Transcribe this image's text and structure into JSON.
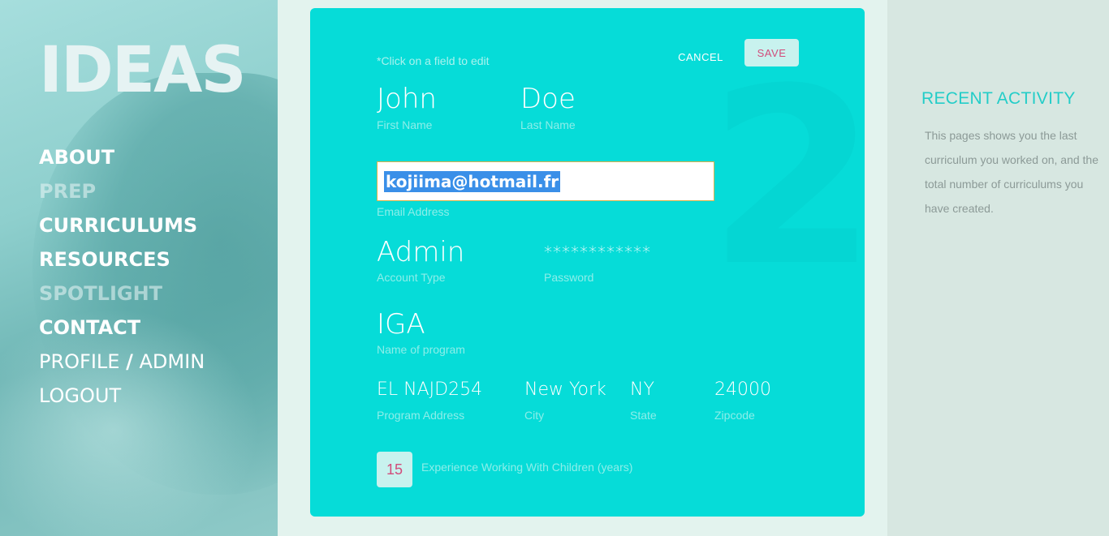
{
  "brand": {
    "logo": "IDEAS"
  },
  "nav": {
    "items": [
      {
        "label": "ABOUT"
      },
      {
        "label": "PREP"
      },
      {
        "label": "CURRICULUMS"
      },
      {
        "label": "RESOURCES"
      },
      {
        "label": "SPOTLIGHT"
      },
      {
        "label": "CONTACT"
      }
    ],
    "profile": "PROFILE",
    "separator": "/",
    "admin": "ADMIN",
    "logout": "LOGOUT"
  },
  "form": {
    "hint": "*Click on a field to edit",
    "cancel_label": "CANCEL",
    "save_label": "SAVE",
    "first_name": {
      "value": "John",
      "label": "First Name"
    },
    "last_name": {
      "value": "Doe",
      "label": "Last Name"
    },
    "email": {
      "value": "kojiima@hotmail.fr",
      "label": "Email Address"
    },
    "account_type": {
      "value": "Admin",
      "label": "Account Type"
    },
    "password": {
      "value": "************",
      "label": "Password"
    },
    "program_name": {
      "value": "IGA",
      "label": "Name of program"
    },
    "program_address": {
      "value": "EL NAJD254",
      "label": "Program Address"
    },
    "city": {
      "value": "New York",
      "label": "City"
    },
    "state": {
      "value": "NY",
      "label": "State"
    },
    "zipcode": {
      "value": "24000",
      "label": "Zipcode"
    },
    "experience": {
      "value": "15",
      "label": "Experience Working With Children (years)"
    }
  },
  "recent_activity": {
    "title": "RECENT ACTIVITY",
    "text": "This pages shows you the last curriculum you worked on, and the total number of curriculums you have created."
  },
  "colors": {
    "card": "#06dcd8",
    "accent_pink": "#d24c7b",
    "heading_teal": "#23cdc8"
  }
}
